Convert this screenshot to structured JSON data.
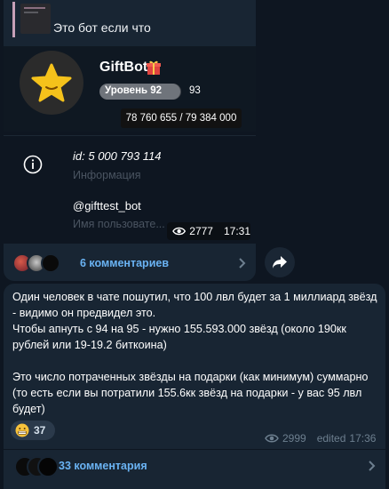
{
  "message1": {
    "reply_text": "Это бот если что",
    "bot_card": {
      "name": "GiftBot",
      "name_emoji_icon": "gift-icon",
      "avatar_icon": "star-icon",
      "level_label": "Уровень 92",
      "next_level": "93",
      "level_progress": 0.99,
      "xp": "78 760 655 / 79 384 000",
      "id_prefix": "id:",
      "id_value": "5 000 793 114",
      "id_label": "Информация",
      "username": "@gifttest_bot",
      "username_label": "Имя пользовате..."
    },
    "views": "2777",
    "time": "17:31",
    "comments": "6 комментариев"
  },
  "message2": {
    "text": "Один человек в чате пошутил, что 100 лвл будет за 1 миллиард звёзд - видимо он предвидел это.\nЧтобы апнуть с 94 на 95 - нужно 155.593.000 звёзд (около 190кк рублей или 19-19.2 биткоина)\n\nЭто число потраченных звёзды на подарки (как минимум) суммарно (то есть если вы потратили 155.6кк звёзд на подарки - у вас 95 лвл будет)",
    "reaction_icon": "grimacing-face-icon",
    "reaction_count": "37",
    "views": "2999",
    "edited_label": "edited",
    "time": "17:36",
    "comments": "33 комментария"
  },
  "colors": {
    "background": "#0e1621",
    "bubble": "#182533",
    "link": "#6ab3f3",
    "muted": "#6d7f8f"
  }
}
